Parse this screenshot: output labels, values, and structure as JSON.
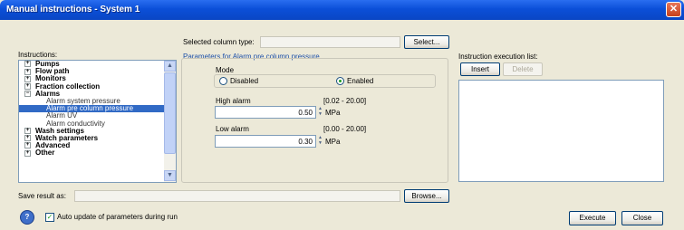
{
  "window": {
    "title": "Manual instructions - System 1",
    "close_glyph": "✕"
  },
  "instructions_label": "Instructions:",
  "selected_column_label": "Selected column type:",
  "select_button": "Select...",
  "params_group_label": "Parameters for Alarm pre column pressure",
  "mode_label": "Mode",
  "mode_options": {
    "disabled": "Disabled",
    "enabled": "Enabled",
    "selected": "Enabled"
  },
  "high_alarm": {
    "label": "High alarm",
    "range": "[0.02 - 20.00]",
    "value": "0.50",
    "unit": "MPa"
  },
  "low_alarm": {
    "label": "Low alarm",
    "range": "[0.00 - 20.00]",
    "value": "0.30",
    "unit": "MPa"
  },
  "execution_list_label": "Instruction execution list:",
  "insert_button": "Insert",
  "delete_button": "Delete",
  "tree": [
    {
      "label": "Pumps",
      "type": "group"
    },
    {
      "label": "Flow path",
      "type": "group"
    },
    {
      "label": "Monitors",
      "type": "group"
    },
    {
      "label": "Fraction collection",
      "type": "group"
    },
    {
      "label": "Alarms",
      "type": "group-open"
    },
    {
      "label": "Alarm system pressure",
      "type": "child"
    },
    {
      "label": "Alarm pre column pressure",
      "type": "child-selected"
    },
    {
      "label": "Alarm UV",
      "type": "child"
    },
    {
      "label": "Alarm conductivity",
      "type": "child"
    },
    {
      "label": "Wash settings",
      "type": "group"
    },
    {
      "label": "Watch parameters",
      "type": "group"
    },
    {
      "label": "Advanced",
      "type": "group"
    },
    {
      "label": "Other",
      "type": "group"
    }
  ],
  "save_result_label": "Save result as:",
  "browse_button": "Browse...",
  "auto_update_label": "Auto update of parameters during run",
  "auto_update_checked": true,
  "execute_button": "Execute",
  "close_button": "Close",
  "icons": {
    "help": "help-icon",
    "expand": "plus-icon",
    "collapse": "minus-icon"
  },
  "colors": {
    "selection": "#316ac5",
    "titlebar": "#0b4fd8",
    "radio_dot": "#21a121"
  }
}
